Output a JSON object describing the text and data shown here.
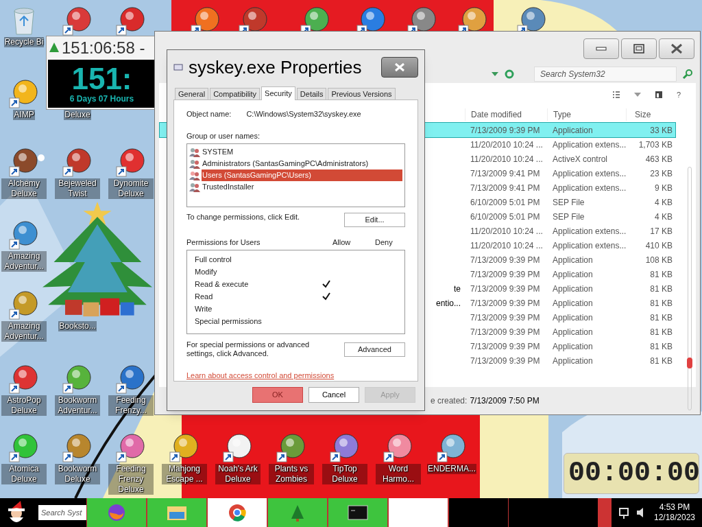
{
  "desktop": {
    "icons": [
      {
        "label": "Recycle Bi",
        "kind": "bin"
      },
      {
        "kind": "app"
      },
      {
        "kind": "app"
      },
      {
        "label": "AIMP",
        "kind": "app"
      },
      {
        "label": "Deluxe",
        "kind": "hidden"
      },
      {
        "label": "Alchemy Deluxe",
        "kind": "app"
      },
      {
        "label": "Bejeweled Twist",
        "kind": "app"
      },
      {
        "label": "Dynomite Deluxe",
        "kind": "app"
      },
      {
        "label": "Amazing Adventur...",
        "kind": "app"
      },
      {
        "label": "Amazing Adventur...",
        "kind": "app"
      },
      {
        "label": "Booksto...",
        "kind": "hidden"
      },
      {
        "label": "AstroPop Deluxe",
        "kind": "app"
      },
      {
        "label": "Bookworm Adventur...",
        "kind": "app"
      },
      {
        "label": "Feeding Frenzy...",
        "kind": "app"
      },
      {
        "label": "Atomica Deluxe",
        "kind": "app"
      },
      {
        "label": "Bookworm Deluxe",
        "kind": "app"
      },
      {
        "label": "Feeding Frenzy Deluxe",
        "kind": "app"
      },
      {
        "label": "Mahjong Escape ...",
        "kind": "app"
      },
      {
        "label": "Noah's Ark Deluxe",
        "kind": "app"
      },
      {
        "label": "Plants vs Zombies",
        "kind": "app"
      },
      {
        "label": "TipTop Deluxe",
        "kind": "app"
      },
      {
        "label": "Word Harmo...",
        "kind": "app"
      },
      {
        "label": "ENDERMA...",
        "kind": "app"
      },
      {
        "kind": "app"
      },
      {
        "kind": "app"
      },
      {
        "kind": "app"
      },
      {
        "kind": "app"
      },
      {
        "kind": "app"
      },
      {
        "kind": "app"
      },
      {
        "kind": "app"
      }
    ]
  },
  "countdown_widget": {
    "title": "151:06:58 -",
    "value": "151:",
    "caption": "6 Days 07 Hours"
  },
  "explorer": {
    "search": {
      "placeholder": "Search System32"
    },
    "help_label": "?",
    "columns": [
      "Date modified",
      "Type",
      "Size"
    ],
    "rows": [
      {
        "date": "7/13/2009 9:39 PM",
        "type": "Application",
        "size": "33 KB",
        "selected": true
      },
      {
        "date": "11/20/2010 10:24 ...",
        "type": "Application extens...",
        "size": "1,703 KB",
        "selected": false
      },
      {
        "date": "11/20/2010 10:24 ...",
        "type": "ActiveX control",
        "size": "463 KB",
        "selected": false
      },
      {
        "date": "7/13/2009 9:41 PM",
        "type": "Application extens...",
        "size": "23 KB",
        "selected": false
      },
      {
        "date": "7/13/2009 9:41 PM",
        "type": "Application extens...",
        "size": "9 KB",
        "selected": false
      },
      {
        "date": "6/10/2009 5:01 PM",
        "type": "SEP File",
        "size": "4 KB",
        "selected": false
      },
      {
        "date": "6/10/2009 5:01 PM",
        "type": "SEP File",
        "size": "4 KB",
        "selected": false
      },
      {
        "date": "11/20/2010 10:24 ...",
        "type": "Application extens...",
        "size": "17 KB",
        "selected": false
      },
      {
        "date": "11/20/2010 10:24 ...",
        "type": "Application extens...",
        "size": "410 KB",
        "selected": false
      },
      {
        "date": "7/13/2009 9:39 PM",
        "type": "Application",
        "size": "108 KB",
        "selected": false
      },
      {
        "date": "7/13/2009 9:39 PM",
        "type": "Application",
        "size": "81 KB",
        "selected": false
      },
      {
        "name": "te",
        "date": "7/13/2009 9:39 PM",
        "type": "Application",
        "size": "81 KB",
        "selected": false
      },
      {
        "name": "entio...",
        "date": "7/13/2009 9:39 PM",
        "type": "Application",
        "size": "81 KB",
        "selected": false
      },
      {
        "date": "7/13/2009 9:39 PM",
        "type": "Application",
        "size": "81 KB",
        "selected": false
      },
      {
        "date": "7/13/2009 9:39 PM",
        "type": "Application",
        "size": "81 KB",
        "selected": false
      },
      {
        "date": "7/13/2009 9:39 PM",
        "type": "Application",
        "size": "81 KB",
        "selected": false
      },
      {
        "date": "7/13/2009 9:39 PM",
        "type": "Application",
        "size": "81 KB",
        "selected": false
      }
    ],
    "status_label": "e created:",
    "status_value": "7/13/2009 7:50 PM"
  },
  "dialog": {
    "title": "syskey.exe Properties",
    "tabs": [
      {
        "label": "General",
        "selected": false
      },
      {
        "label": "Compatibility",
        "selected": false
      },
      {
        "label": "Security",
        "selected": true
      },
      {
        "label": "Details",
        "selected": false
      },
      {
        "label": "Previous Versions",
        "selected": false
      }
    ],
    "object_name_label": "Object name:",
    "object_name": "C:\\Windows\\System32\\syskey.exe",
    "users_label": "Group or user names:",
    "users": [
      {
        "name": "SYSTEM",
        "selected": false
      },
      {
        "name": "Administrators (SantasGamingPC\\Administrators)",
        "selected": false
      },
      {
        "name": "Users (SantasGamingPC\\Users)",
        "selected": true
      },
      {
        "name": "TrustedInstaller",
        "selected": false
      }
    ],
    "edit_hint": "To change permissions, click Edit.",
    "edit_button": "Edit...",
    "permissions_label": "Permissions for Users",
    "allow_label": "Allow",
    "deny_label": "Deny",
    "permissions": [
      {
        "name": "Full control",
        "allow": false,
        "deny": false
      },
      {
        "name": "Modify",
        "allow": false,
        "deny": false
      },
      {
        "name": "Read & execute",
        "allow": true,
        "deny": false
      },
      {
        "name": "Read",
        "allow": true,
        "deny": false
      },
      {
        "name": "Write",
        "allow": false,
        "deny": false
      },
      {
        "name": "Special permissions",
        "allow": false,
        "deny": false
      }
    ],
    "advanced_hint": "For special permissions or advanced settings, click Advanced.",
    "advanced_button": "Advanced",
    "link": "Learn about access control and permissions",
    "buttons": [
      {
        "label": "OK",
        "default": true,
        "disabled": false
      },
      {
        "label": "Cancel",
        "default": false,
        "disabled": false
      },
      {
        "label": "Apply",
        "default": false,
        "disabled": true
      }
    ]
  },
  "stopwatch": {
    "time": "00:00:00"
  },
  "taskbar": {
    "search": {
      "placeholder": "Search Syst"
    },
    "time": "4:53 PM",
    "date": "12/18/2023"
  }
}
